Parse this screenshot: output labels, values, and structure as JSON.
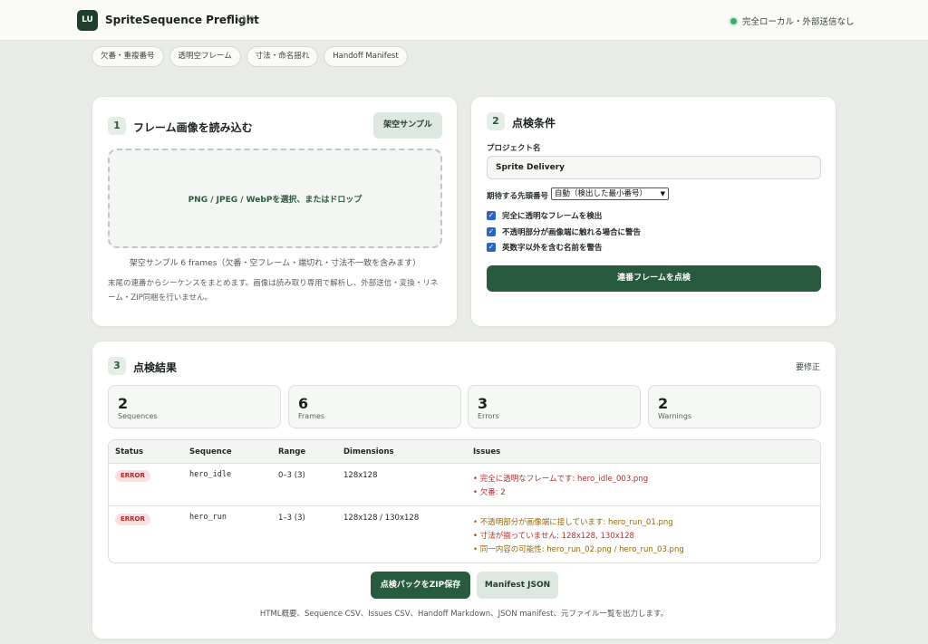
{
  "header": {
    "logo_text": "LU",
    "app_title": "SpriteSequence Preflight",
    "version": "v1.0",
    "status_text": "完全ローカル・外部送信なし",
    "status_color": "#3faa6a"
  },
  "chips": [
    "欠番・重複番号",
    "透明空フレーム",
    "寸法・命名揺れ",
    "Handoff Manifest"
  ],
  "load_panel": {
    "step": "1",
    "title": "フレーム画像を読み込む",
    "sample_button": "架空サンプル",
    "dropzone_text": "PNG / JPEG / WebPを選択、またはドロップ",
    "sample_note": "架空サンプル 6 frames（欠番・空フレーム・端切れ・寸法不一致を含みます）",
    "description": "末尾の連番からシーケンスをまとめます。画像は読み取り専用で解析し、外部送信・変換・リネーム・ZIP同梱を行いません。"
  },
  "conditions_panel": {
    "step": "2",
    "title": "点検条件",
    "project_label": "プロジェクト名",
    "project_value": "Sprite Delivery",
    "start_label": "期待する先頭番号",
    "start_selected": "自動（検出した最小番号）",
    "checks": [
      {
        "label": "完全に透明なフレームを検出",
        "checked": true
      },
      {
        "label": "不透明部分が画像端に触れる場合に警告",
        "checked": true
      },
      {
        "label": "英数字以外を含む名前を警告",
        "checked": true
      }
    ],
    "run_button": "連番フレームを点検"
  },
  "results_panel": {
    "step": "3",
    "title": "点検結果",
    "status": "要修正",
    "stats": [
      {
        "value": "2",
        "label": "Sequences"
      },
      {
        "value": "6",
        "label": "Frames"
      },
      {
        "value": "3",
        "label": "Errors"
      },
      {
        "value": "2",
        "label": "Warnings"
      }
    ],
    "columns": [
      "Status",
      "Sequence",
      "Range",
      "Dimensions",
      "Issues"
    ],
    "rows": [
      {
        "status": "ERROR",
        "sequence": "hero_idle",
        "range": "0–3 (3)",
        "dimensions": "128x128",
        "issues": [
          {
            "text": "• 完全に透明なフレームです: hero_idle_003.png",
            "level": "error"
          },
          {
            "text": "• 欠番: 2",
            "level": "error"
          }
        ]
      },
      {
        "status": "ERROR",
        "sequence": "hero_run",
        "range": "1–3 (3)",
        "dimensions": "128x128 / 130x128",
        "issues": [
          {
            "text": "• 不透明部分が画像端に接しています: hero_run_01.png",
            "level": "warning"
          },
          {
            "text": "• 寸法が揃っていません: 128x128, 130x128",
            "level": "error"
          },
          {
            "text": "• 同一内容の可能性: hero_run_02.png / hero_run_03.png",
            "level": "warning"
          }
        ]
      }
    ],
    "zip_button": "点検パックをZIP保存",
    "manifest_button": "Manifest JSON",
    "footer_note": "HTML概要、Sequence CSV、Issues CSV、Handoff Markdown、JSON manifest、元ファイル一覧を出力します。"
  },
  "colors": {
    "accent": "#285a3d",
    "error": "#b4312f",
    "warning": "#966a06",
    "checkbox": "#2a63c9"
  }
}
